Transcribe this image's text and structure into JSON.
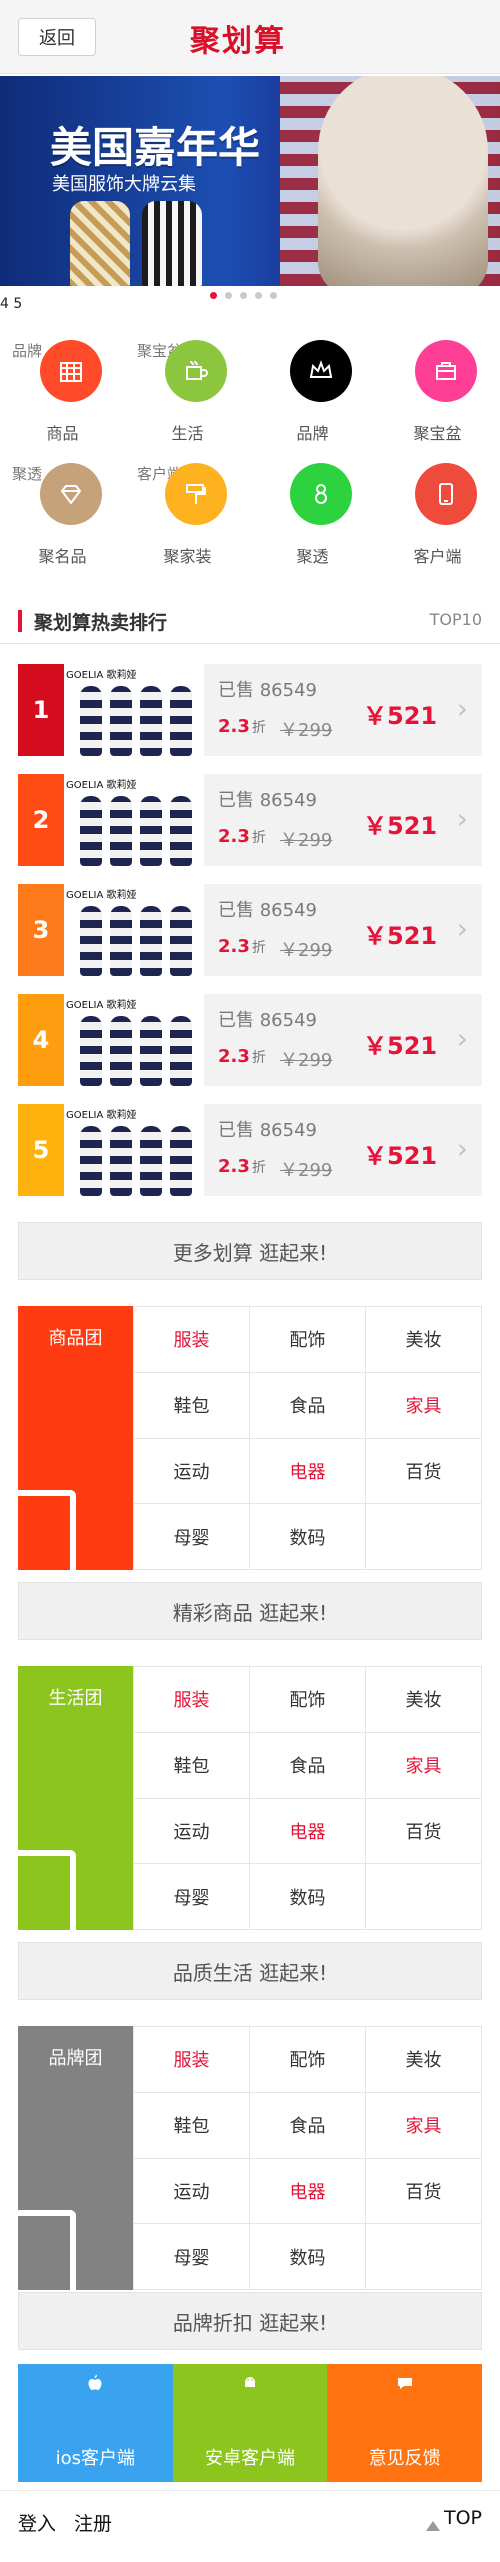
{
  "header": {
    "back_label": "返回",
    "logo_text": "聚划算",
    "accent": "#d8102a"
  },
  "banner": {
    "title": "美国嘉年华",
    "subtitle": "美国服饰大牌云集",
    "slide_indicator": "4 5",
    "dots_count": 5,
    "active_dot": 0
  },
  "grid": {
    "items": [
      {
        "label": "商品",
        "ghost": "品牌",
        "color": "#ff4b2a",
        "icon": "calendar-grid-icon"
      },
      {
        "label": "生活",
        "ghost": "聚宝盆",
        "color": "#8cc63e",
        "icon": "cup-icon"
      },
      {
        "label": "品牌",
        "ghost": "",
        "color": "#000000",
        "icon": "crown-icon"
      },
      {
        "label": "聚宝盆",
        "ghost": "",
        "color": "#ff3f95",
        "icon": "briefcase-icon"
      },
      {
        "label": "聚名品",
        "ghost": "聚透",
        "color": "#c6a27a",
        "icon": "diamond-icon"
      },
      {
        "label": "聚家装",
        "ghost": "客户端",
        "color": "#ffb21f",
        "icon": "paint-roller-icon"
      },
      {
        "label": "聚透",
        "ghost": "",
        "color": "#2dd33e",
        "icon": "number-8-icon"
      },
      {
        "label": "客户端",
        "ghost": "",
        "color": "#ef4b3c",
        "icon": "phone-icon"
      }
    ]
  },
  "ranking": {
    "title": "聚划算热卖排行",
    "right_label": "TOP10",
    "brand_text": "GOELIA 歌莉娅",
    "rows": [
      {
        "num": "1",
        "color": "#d50c1e",
        "sold": "已售 86549",
        "discount": "2.3",
        "discount_unit": "折",
        "orig": "￥299",
        "price": "￥521"
      },
      {
        "num": "2",
        "color": "#ff4c14",
        "sold": "已售 86549",
        "discount": "2.3",
        "discount_unit": "折",
        "orig": "￥299",
        "price": "￥521"
      },
      {
        "num": "3",
        "color": "#ff7a1a",
        "sold": "已售 86549",
        "discount": "2.3",
        "discount_unit": "折",
        "orig": "￥299",
        "price": "￥521"
      },
      {
        "num": "4",
        "color": "#ff9d10",
        "sold": "已售 86549",
        "discount": "2.3",
        "discount_unit": "折",
        "orig": "￥299",
        "price": "￥521"
      },
      {
        "num": "5",
        "color": "#ffb20d",
        "sold": "已售 86549",
        "discount": "2.3",
        "discount_unit": "折",
        "orig": "￥299",
        "price": "￥521"
      }
    ]
  },
  "sections": [
    {
      "more_label": "更多划算 逛起来!",
      "name": "商品团",
      "color": "#ff3b11",
      "cells": [
        "服装",
        "配饰",
        "美妆",
        "鞋包",
        "食品",
        "家具",
        "运动",
        "电器",
        "百货",
        "母婴",
        "数码",
        ""
      ],
      "red": [
        0,
        5,
        7
      ]
    },
    {
      "more_label": "精彩商品 逛起来!",
      "name": "生活团",
      "color": "#8cc51e",
      "cells": [
        "服装",
        "配饰",
        "美妆",
        "鞋包",
        "食品",
        "家具",
        "运动",
        "电器",
        "百货",
        "母婴",
        "数码",
        ""
      ],
      "red": [
        0,
        5,
        7
      ]
    },
    {
      "more_label": "品质生活 逛起来!",
      "name": "品牌团",
      "color": "#828282",
      "cells": [
        "服装",
        "配饰",
        "美妆",
        "鞋包",
        "食品",
        "家具",
        "运动",
        "电器",
        "百货",
        "母婴",
        "数码",
        ""
      ],
      "red": [
        0,
        5,
        7
      ]
    }
  ],
  "brand_discount_label": "品牌折扣 逛起来!",
  "apps": [
    {
      "label": "ios客户端",
      "color": "#3aa3f0",
      "icon": "apple-icon"
    },
    {
      "label": "安卓客户端",
      "color": "#8cc51e",
      "icon": "android-icon"
    },
    {
      "label": "意见反馈",
      "color": "#ff7410",
      "icon": "chat-bubble-icon"
    }
  ],
  "bottom": {
    "login": "登入",
    "register": "注册",
    "top": "TOP"
  }
}
